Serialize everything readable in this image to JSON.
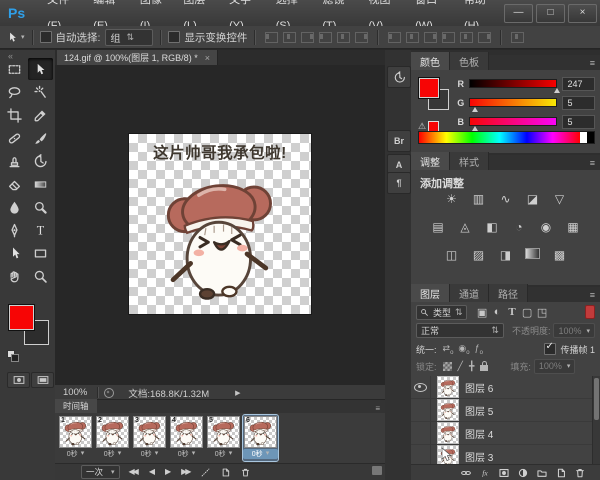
{
  "menu": {
    "logo": "Ps",
    "items": [
      "文件(F)",
      "编辑(E)",
      "图像(I)",
      "图层(L)",
      "文字(Y)",
      "选择(S)",
      "滤镜(T)",
      "视图(V)",
      "窗口(W)",
      "帮助(H)"
    ]
  },
  "window_controls": {
    "minimize": "—",
    "maximize": "□",
    "close": "×"
  },
  "options_bar": {
    "auto_select_label": "自动选择:",
    "auto_select_value": "组",
    "show_transform_label": "显示变换控件"
  },
  "document_tab": {
    "title": "124.gif @ 100%(图层 1, RGB/8) *",
    "close": "×"
  },
  "canvas": {
    "caption": "这片帅哥我承包啦!"
  },
  "status_bar": {
    "zoom": "100%",
    "info": "文档:168.8K/1.32M"
  },
  "toolbar": {
    "selected_tool": "move",
    "foreground_color": "#f70505",
    "background_color": "#303030",
    "tools": [
      "rectangular-marquee",
      "move",
      "lasso",
      "magic-wand",
      "crop",
      "eyedropper",
      "healing-brush",
      "brush",
      "clone-stamp",
      "history-brush",
      "eraser",
      "gradient",
      "blur",
      "dodge",
      "pen",
      "type",
      "path-selection",
      "rectangle-shape",
      "hand",
      "zoom"
    ]
  },
  "dock_strip": {
    "items": [
      {
        "name": "history",
        "glyph": ""
      },
      {
        "name": "mini-bridge",
        "glyph": "Br"
      },
      {
        "name": "character",
        "glyph": "A"
      },
      {
        "name": "paragraph",
        "glyph": "¶"
      }
    ]
  },
  "color_panel": {
    "tabs": [
      "颜色",
      "色板"
    ],
    "active_tab": "颜色",
    "channels": [
      {
        "label": "R",
        "value": 247,
        "max": 255
      },
      {
        "label": "G",
        "value": 5,
        "max": 255
      },
      {
        "label": "B",
        "value": 5,
        "max": 255
      }
    ]
  },
  "adjustments_panel": {
    "tabs": [
      "调整",
      "样式"
    ],
    "active_tab": "调整",
    "title": "添加调整",
    "rows": [
      [
        "brightness-contrast",
        "levels",
        "curves",
        "exposure",
        "vibrance"
      ],
      [
        "hue-saturation",
        "color-balance",
        "black-white",
        "photo-filter",
        "channel-mixer",
        "color-lookup"
      ],
      [
        "invert",
        "posterize",
        "threshold",
        "gradient-map",
        "selective-color"
      ]
    ]
  },
  "layers_panel": {
    "tabs": [
      "图层",
      "通道",
      "路径"
    ],
    "active_tab": "图层",
    "filter_label": "类型",
    "filter_icons": [
      "pixel-layer-filter",
      "adjustment-layer-filter",
      "type-layer-filter",
      "shape-layer-filter",
      "smart-object-filter"
    ],
    "blend_mode": "正常",
    "opacity_label": "不透明度:",
    "opacity_value": "100%",
    "unify_label": "统一:",
    "propagate_checked": true,
    "propagate_label": "传播帧 1",
    "lock_label": "锁定:",
    "fill_label": "填充:",
    "fill_value": "100%",
    "layers": [
      {
        "name": "图层 6",
        "visible": true
      },
      {
        "name": "图层 5",
        "visible": false
      },
      {
        "name": "图层 4",
        "visible": false
      },
      {
        "name": "图层 3",
        "visible": false
      }
    ],
    "bottom_icons": [
      "link",
      "fx",
      "mask",
      "adjustment",
      "group",
      "new-layer",
      "delete"
    ]
  },
  "timeline": {
    "tab": "时间轴",
    "loop_option": "一次",
    "selected_frame": 6,
    "frames": [
      {
        "number": "1",
        "duration": "0秒"
      },
      {
        "number": "2",
        "duration": "0秒"
      },
      {
        "number": "3",
        "duration": "0秒"
      },
      {
        "number": "4",
        "duration": "0秒"
      },
      {
        "number": "5",
        "duration": "0秒"
      },
      {
        "number": "6",
        "duration": "0秒"
      }
    ],
    "playback": [
      "first-frame",
      "previous-frame",
      "play",
      "next-frame"
    ]
  }
}
